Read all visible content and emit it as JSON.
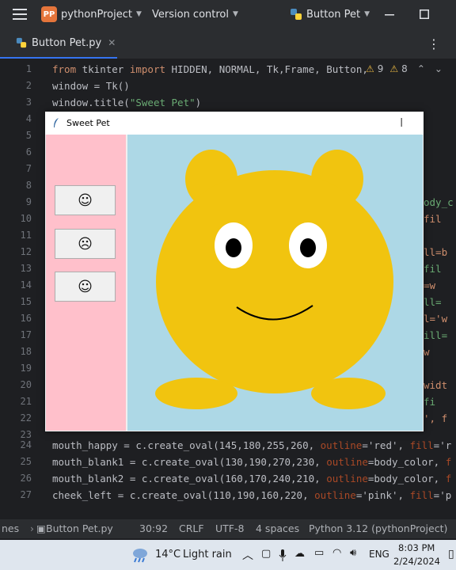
{
  "topbar": {
    "project_badge": "PP",
    "project_name": "pythonProject",
    "vcs": "Version control",
    "run_config": "Button Pet"
  },
  "tabs": [
    {
      "label": "Button Pet.py"
    }
  ],
  "inspections": {
    "warnings": "9",
    "weak_warnings": "8"
  },
  "line_numbers": [
    "1",
    "2",
    "3",
    "4",
    "5",
    "6",
    "7",
    "8",
    "9",
    "10",
    "11",
    "12",
    "13",
    "14",
    "15",
    "16",
    "17",
    "18",
    "19",
    "20",
    "21",
    "22",
    "23",
    "24",
    "25",
    "26",
    "27"
  ],
  "code": {
    "line1": {
      "kw1": "from",
      "mod": " tkinter ",
      "kw2": "import",
      "rest": " HIDDEN, NORMAL, Tk,Frame, Button,"
    },
    "line2": "window = Tk()",
    "line3": {
      "pre": "window.title(",
      "str": "\"Sweet Pet\"",
      "post": ")"
    },
    "line24": {
      "pre": "mouth_happy = c.create_oval(145,180,255,260, ",
      "p1": "outline",
      "mid": "='red', ",
      "p2": "fill",
      "post": "='r"
    },
    "line25": {
      "pre": "mouth_blank1 = c.create_oval(130,190,270,230, ",
      "p1": "outline",
      "mid": "=body_color, ",
      "p2": "f"
    },
    "line26": {
      "pre": "mouth_blank2 = c.create_oval(160,170,240,210, ",
      "p1": "outline",
      "mid": "=body_color, ",
      "p2": "f"
    },
    "line27": {
      "pre": "cheek_left = c.create_oval(110,190,160,220, ",
      "p1": "outline",
      "mid": "='pink', ",
      "p2": "fill",
      "post": "='p"
    }
  },
  "peek_right": [
    "ody_c",
    "fil",
    "",
    "ll=b",
    "fil",
    "=w",
    "ll=",
    "l='w",
    "ill=",
    "w",
    "",
    "widt",
    "fi",
    "', f"
  ],
  "tk_window": {
    "title": "Sweet Pet",
    "buttons": [
      {
        "label": "☺",
        "icon": "happy-face"
      },
      {
        "label": "☹",
        "icon": "sad-face"
      },
      {
        "label": "☺",
        "icon": "wink-face"
      }
    ],
    "colors": {
      "frame": "#ffc0cb",
      "canvas": "#add8e6",
      "body": "#f1c40f"
    }
  },
  "statusbar": {
    "breadcrumb": "nes",
    "file": "Button Pet.py",
    "position": "30:92",
    "line_sep": "CRLF",
    "encoding": "UTF-8",
    "indent": "4 spaces",
    "interpreter": "Python 3.12 (pythonProject)"
  },
  "taskbar": {
    "weather_temp": "14°C",
    "weather_desc": "Light rain",
    "lang": "ENG",
    "time": "8:03 PM",
    "date": "2/24/2024"
  }
}
